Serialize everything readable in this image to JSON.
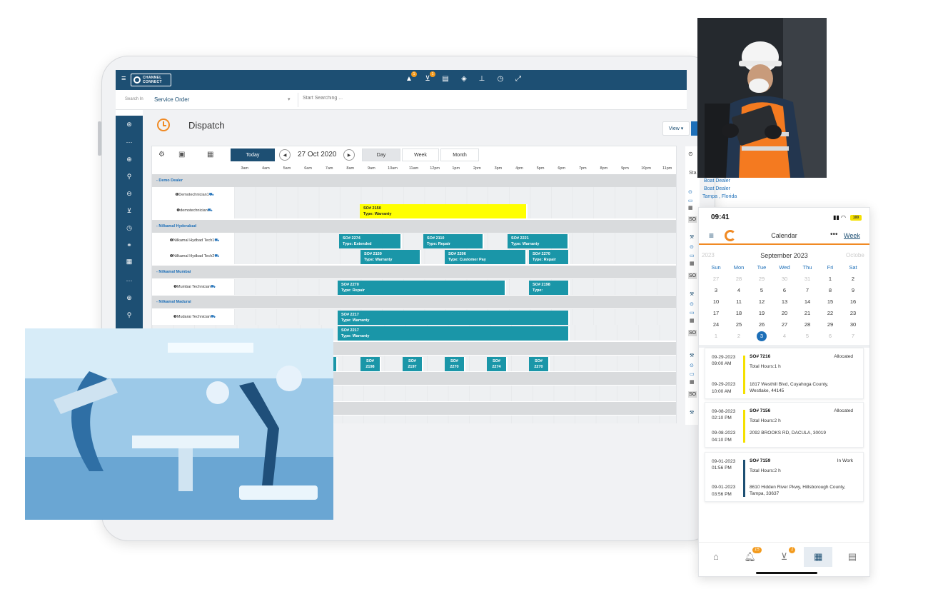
{
  "app": {
    "logo_text": "CHANNEL CONNECT",
    "logo_line1": "CHANNEL",
    "logo_line2": "CONNECT"
  },
  "topbar": {
    "icons": [
      "bell-icon",
      "cart-icon",
      "inbox-icon",
      "box-icon",
      "upload-icon",
      "help-icon",
      "expand-icon"
    ],
    "badges": [
      "1",
      "1"
    ]
  },
  "search": {
    "label": "Search In",
    "scope": "Service Order",
    "placeholder": "Start Searching ..."
  },
  "page": {
    "title": "Dispatch",
    "view_label": "View ▾"
  },
  "calendar": {
    "today": "Today",
    "date": "27 Oct 2020",
    "views": [
      "Day",
      "Week",
      "Month"
    ],
    "hours": [
      "3am",
      "4am",
      "5am",
      "6am",
      "7am",
      "8am",
      "9am",
      "10am",
      "11am",
      "12pm",
      "1pm",
      "2pm",
      "3pm",
      "4pm",
      "5pm",
      "6pm",
      "7pm",
      "8pm",
      "9pm",
      "10pm",
      "11pm"
    ],
    "groups": [
      {
        "dealer": "- Demo Dealer",
        "techs": [
          "Demotechnician1",
          "demotechnician"
        ]
      },
      {
        "dealer": "- Nilkamal Hyderabad",
        "techs": [
          "Nilkamal Hydbad Tech1",
          "Nilkamal Hydbad Tech2"
        ]
      },
      {
        "dealer": "- Nilkamal Mumbai",
        "techs": [
          "Mumbai Technician"
        ]
      },
      {
        "dealer": "- Nilkamal Madurai",
        "techs": [
          "Mudarai Technician"
        ]
      }
    ],
    "events": {
      "e1": {
        "so": "SO# 2150",
        "type": "Type: Warranty"
      },
      "e2": {
        "so": "SO# 2274",
        "type": "Type: Extended"
      },
      "e3": {
        "so": "SO# 2110",
        "type": "Type: Repair"
      },
      "e4": {
        "so": "SO# 2221",
        "type": "Type: Warranty"
      },
      "e5": {
        "so": "SO# 2150",
        "type": "Type: Warranty"
      },
      "e6": {
        "so": "SO# 2206",
        "type": "Type: Customer Pay"
      },
      "e7": {
        "so": "SO# 2270",
        "type": "Type: Repair"
      },
      "e8": {
        "so": "SO# 2270",
        "type": "Type: Repair"
      },
      "e9": {
        "so": "SO# 2198",
        "type": "Type:"
      },
      "e10": {
        "so": "SO# 2217",
        "type": "Type: Warranty"
      },
      "e11": {
        "so": "SO# 2217",
        "type": "Type: Warranty"
      },
      "small": [
        {
          "l1": "SO#",
          "l2": "2198"
        },
        {
          "l1": "SO#",
          "l2": "2197"
        },
        {
          "l1": "SO#",
          "l2": "2270"
        },
        {
          "l1": "SO#",
          "l2": "2274"
        },
        {
          "l1": "SO#",
          "l2": "2270"
        }
      ]
    }
  },
  "right_panel": {
    "header": "Sta",
    "dealer": "Boat Dealer",
    "dealer_top": "Boat Dealer",
    "location": "Tampa , Florida",
    "tag": "SO"
  },
  "phone": {
    "time": "09:41",
    "battery": "100",
    "title": "Calendar",
    "more": "•••",
    "view": "Week",
    "month_prev": "2023",
    "month": "September 2023",
    "month_next": "Octobe",
    "weekdays": [
      "Sun",
      "Mon",
      "Tue",
      "Wed",
      "Thu",
      "Fri",
      "Sat"
    ],
    "days": [
      [
        "27",
        "28",
        "29",
        "30",
        "31",
        "1",
        "2"
      ],
      [
        "3",
        "4",
        "5",
        "6",
        "7",
        "8",
        "9"
      ],
      [
        "10",
        "11",
        "12",
        "13",
        "14",
        "15",
        "16"
      ],
      [
        "17",
        "18",
        "19",
        "20",
        "21",
        "22",
        "23"
      ],
      [
        "24",
        "25",
        "26",
        "27",
        "28",
        "29",
        "30"
      ],
      [
        "1",
        "2",
        "3",
        "4",
        "5",
        "6",
        "7"
      ]
    ],
    "cards": [
      {
        "d1": "09-29-2023",
        "t1": "09:00 AM",
        "d2": "09-29-2023",
        "t2": "10:00 AM",
        "so": "SO# 7216",
        "status": "Allocated",
        "hours": "Total Hours:1 h",
        "addr": "1817 Westhill Blvd, Cuyahoga County, Westlake, 44145",
        "color": "#f5e000"
      },
      {
        "d1": "09-08-2023",
        "t1": "02:10 PM",
        "d2": "09-08-2023",
        "t2": "04:10 PM",
        "so": "SO# 7156",
        "status": "Allocated",
        "hours": "Total Hours:2 h",
        "addr": "2092 BROOKS RD, DACULA, 30019",
        "color": "#f5e000"
      },
      {
        "d1": "09-01-2023",
        "t1": "01:56 PM",
        "d2": "09-01-2023",
        "t2": "03:56 PM",
        "so": "SO# 7159",
        "status": "In Work",
        "hours": "Total Hours:2 h",
        "addr": "8610 Hidden River Pkwy, Hillsborough County, Tampa, 33637",
        "color": "#1d4f73"
      }
    ],
    "tabs": [
      "home-icon",
      "bell-icon",
      "cart-icon",
      "calendar-icon",
      "book-icon"
    ],
    "tab_badges": {
      "bell": "15",
      "cart": "1"
    }
  }
}
